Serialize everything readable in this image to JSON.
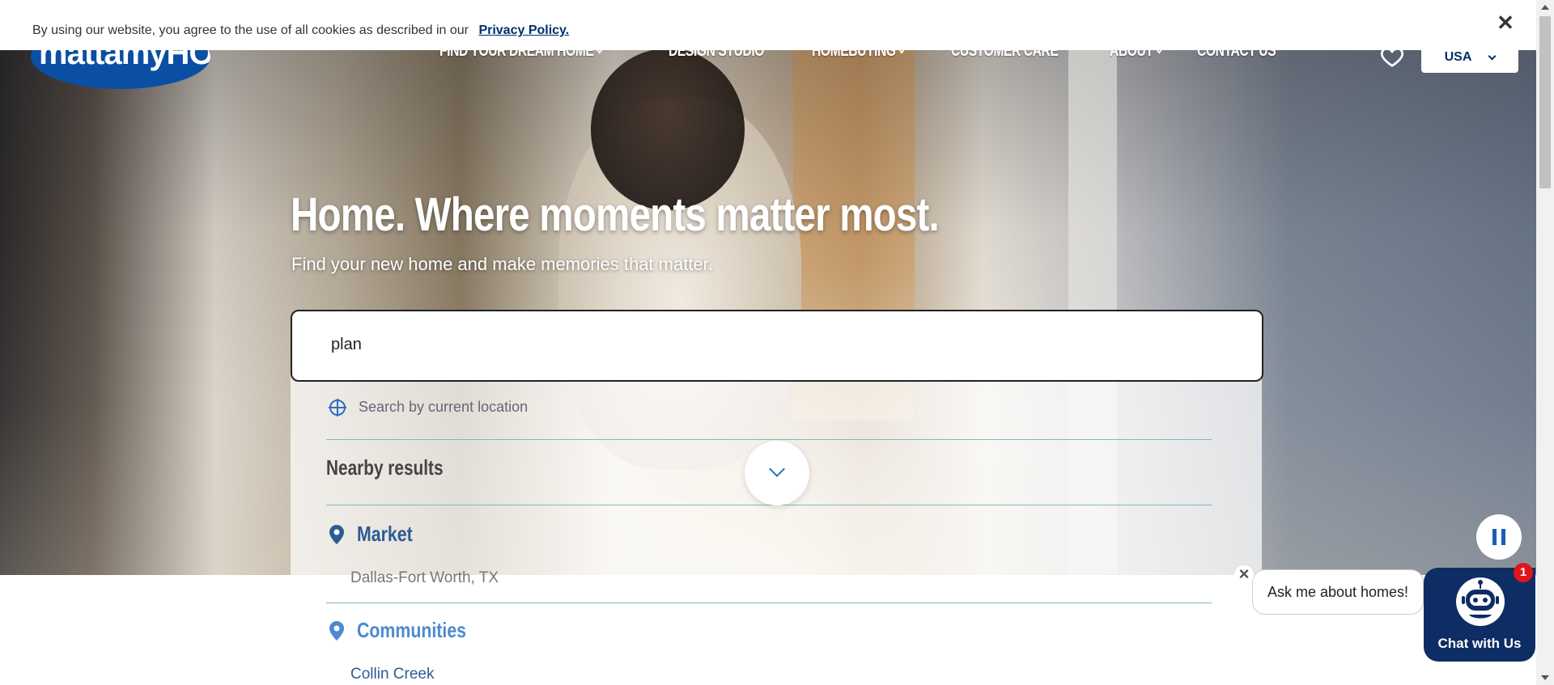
{
  "cookie": {
    "text": "By using our website, you agree to the use of all cookies as described in our",
    "link": "Privacy Policy."
  },
  "logo": {
    "text": "mattamyHOMES"
  },
  "nav": {
    "items": [
      {
        "label": "FIND YOUR DREAM HOME",
        "dropdown": true
      },
      {
        "label": "DESIGN STUDIO",
        "dropdown": false
      },
      {
        "label": "HOMEBUYING",
        "dropdown": true
      },
      {
        "label": "CUSTOMER CARE",
        "dropdown": false
      },
      {
        "label": "ABOUT",
        "dropdown": true
      },
      {
        "label": "CONTACT US",
        "dropdown": false
      }
    ],
    "country": "USA"
  },
  "hero": {
    "headline": "Home. Where moments matter most.",
    "subhead": "Find your new home and make memories that matter."
  },
  "search": {
    "value": "plan",
    "current_location": "Search by current location",
    "nearby_heading": "Nearby results",
    "groups": [
      {
        "label": "Market",
        "items": [
          "Dallas-Fort Worth, TX"
        ]
      },
      {
        "label": "Communities",
        "items": [
          "Collin Creek"
        ]
      }
    ]
  },
  "chat": {
    "prompt": "Ask me about homes!",
    "label": "Chat with Us",
    "badge": "1"
  },
  "colors": {
    "brand_blue": "#0a4fa3",
    "navy": "#0e2d64",
    "badge_red": "#e0151b"
  }
}
